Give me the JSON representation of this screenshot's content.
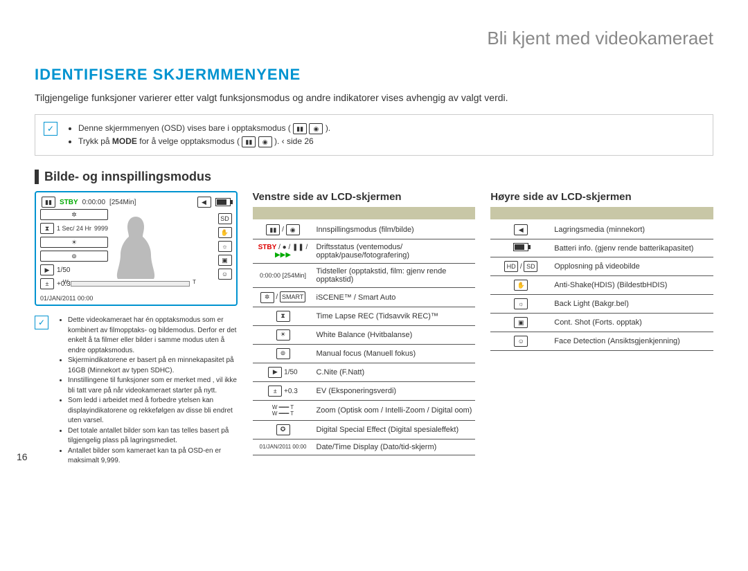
{
  "page_number": "16",
  "chapter_title": "Bli kjent med videokameraet",
  "section_title": "IDENTIFISERE SKJERMMENYENE",
  "intro": "Tilgjengelige funksjoner varierer etter valgt funksjonsmodus og andre indikatorer vises avhengig av valgt verdi.",
  "notebox": {
    "item1": "Denne skjermmenyen (OSD) vises bare i opptaksmodus (  ",
    "item1_tail": " ).",
    "item2_a": "Trykk på ",
    "item2_mode": "MODE",
    "item2_b": " for å velge opptaksmodus (  ",
    "item2_tail": " ).  ‹ side 26"
  },
  "subheading": "Bilde- og innspillingsmodus",
  "lcd": {
    "stby": "STBY",
    "counter": "0:00:00",
    "remain": "[254Min]",
    "sec": "1 Sec/ 24 Hr",
    "count": "9999",
    "cnite": "1/50",
    "ev": "+0.3",
    "sd": "SD",
    "date": "01/JAN/2011 00:00"
  },
  "footnotes": {
    "f1": "Dette videokameraet har én opptaksmodus som er kombinert av filmopptaks- og bildemodus. Derfor er det enkelt å ta filmer eller bilder i samme modus uten å endre opptaksmodus.",
    "f2": "Skjermindikatorene er basert på en minnekapasitet på 16GB (Minnekort av typen SDHC).",
    "f3": "Innstillingene til funksjoner som er merket med ‚ vil ikke bli tatt vare på når videokameraet starter på nytt.",
    "f4": "Som ledd i arbeidet med å forbedre ytelsen kan displayindikatorene og rekkefølgen av disse bli endret uten varsel.",
    "f5": "Det totale antallet bilder som kan tas telles basert på tilgjengelig plass på lagringsmediet.",
    "f6": "Antallet bilder som kameraet kan ta på OSD-en er maksimalt 9,999."
  },
  "left_table_heading": "Venstre side av LCD-skjermen",
  "right_table_heading": "Høyre side av LCD-skjermen",
  "left_rows": [
    {
      "icon_label": "film / foto",
      "desc": "Innspillingsmodus (film/bilde)"
    },
    {
      "icon_label": "STBY / ● / ❚❚ / ▶▶▶",
      "desc": "Driftsstatus (ventemodus/ opptak/pause/fotografering)"
    },
    {
      "icon_label": "0:00:00 [254Min]",
      "desc": "Tidsteller (opptakstid, film: gjenv rende opptakstid)"
    },
    {
      "icon_label": "iSCENE / SMART AUTO",
      "desc": "iSCENE™ / Smart Auto"
    },
    {
      "icon_label": "time-lapse",
      "desc": "Time Lapse REC (Tidsavvik REC)™"
    },
    {
      "icon_label": "WB",
      "desc": "White Balance (Hvitbalanse)"
    },
    {
      "icon_label": "MF",
      "desc": "Manual focus (Manuell fokus)"
    },
    {
      "icon_label": "▶  1/50",
      "desc": "C.Nite (F.Natt)"
    },
    {
      "icon_label": "±  +0.3",
      "desc": "EV (Eksponeringsverdi)"
    },
    {
      "icon_label": "W ━━ T",
      "desc": "Zoom (Optisk oom / Intelli-Zoom / Digital oom)"
    },
    {
      "icon_label": "effect",
      "desc": "Digital Special Effect (Digital spesialeffekt)"
    },
    {
      "icon_label": "01/JAN/2011 00:00",
      "desc": "Date/Time Display (Dato/tid-skjerm)"
    }
  ],
  "right_rows": [
    {
      "icon_label": "card",
      "desc": "Lagringsmedia (minnekort)"
    },
    {
      "icon_label": "battery",
      "desc": "Batteri info. (gjenv rende batterikapasitet)"
    },
    {
      "icon_label": "[HD] / SD",
      "desc": "Opplosning på videobilde"
    },
    {
      "icon_label": "hand",
      "desc": "Anti-Shake(HDIS) (BildestbHDIS)"
    },
    {
      "icon_label": "backlight",
      "desc": "Back Light (Bakgr.bel)"
    },
    {
      "icon_label": "cont",
      "desc": "Cont. Shot (Forts. opptak)"
    },
    {
      "icon_label": "face",
      "desc": "Face Detection (Ansiktsgjenkjenning)"
    }
  ]
}
